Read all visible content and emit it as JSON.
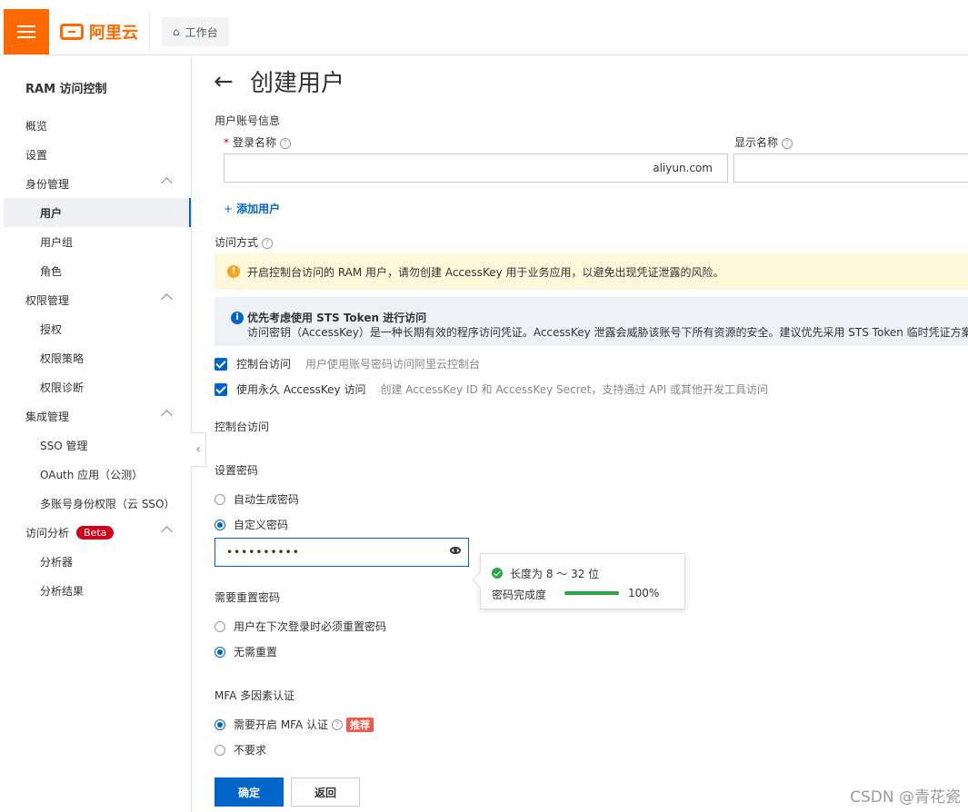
{
  "header": {
    "logo_text": "阿里云",
    "workbench_label": "工作台"
  },
  "sidebar": {
    "title": "RAM 访问控制",
    "items": [
      {
        "label": "概览"
      },
      {
        "label": "设置"
      },
      {
        "label": "身份管理"
      },
      {
        "label": "用户"
      },
      {
        "label": "用户组"
      },
      {
        "label": "角色"
      },
      {
        "label": "权限管理"
      },
      {
        "label": "授权"
      },
      {
        "label": "权限策略"
      },
      {
        "label": "权限诊断"
      },
      {
        "label": "集成管理"
      },
      {
        "label": "SSO 管理"
      },
      {
        "label": "OAuth 应用（公测）"
      },
      {
        "label": "多账号身份权限（云 SSO）"
      },
      {
        "label": "访问分析"
      },
      {
        "label": "分析器"
      },
      {
        "label": "分析结果"
      }
    ],
    "beta_badge": "Beta"
  },
  "main": {
    "title": "创建用户",
    "account_section": "用户账号信息",
    "login_name_label": "登录名称",
    "login_name_value": "aliyun.com",
    "display_name_label": "显示名称",
    "display_name_value": "",
    "add_user": "添加用户",
    "access_mode_label": "访问方式",
    "warning_text": "开启控制台访问的 RAM 用户，请勿创建 AccessKey 用于业务应用，以避免出现凭证泄露的风险。",
    "info_title": "优先考虑使用 STS Token 进行访问",
    "info_body": "访问密钥（AccessKey）是一种长期有效的程序访问凭证。AccessKey 泄露会威胁该账号下所有资源的安全。建议优先采用 STS Token 临时凭证方案，降",
    "console_access_label": "控制台访问",
    "console_access_hint": "用户使用账号密码访问阿里云控制台",
    "ak_access_label": "使用永久 AccessKey 访问",
    "ak_access_hint": "创建 AccessKey ID 和 AccessKey Secret，支持通过 API 或其他开发工具访问",
    "console_section": "控制台访问",
    "set_password_label": "设置密码",
    "auto_pwd": "自动生成密码",
    "custom_pwd": "自定义密码",
    "password_mask": "••••••••••",
    "reset_label": "需要重置密码",
    "reset_next_login": "用户在下次登录时必须重置密码",
    "no_reset": "无需重置",
    "mfa_label": "MFA 多因素认证",
    "mfa_required": "需要开启 MFA 认证",
    "recommend_tag": "推荐",
    "mfa_not_required": "不要求",
    "confirm_button": "确定",
    "back_button": "返回"
  },
  "password_popover": {
    "length_rule": "长度为 8 ～ 32 位",
    "strength_label": "密码完成度",
    "strength_value": "100%",
    "strength_percent": 100
  },
  "watermark": "CSDN @青花瓷",
  "colors": {
    "brand": "#ff6a00",
    "primary": "#0064c8",
    "success": "#28a745",
    "warning_bg": "#fff7d9",
    "danger": "#d0021b"
  }
}
